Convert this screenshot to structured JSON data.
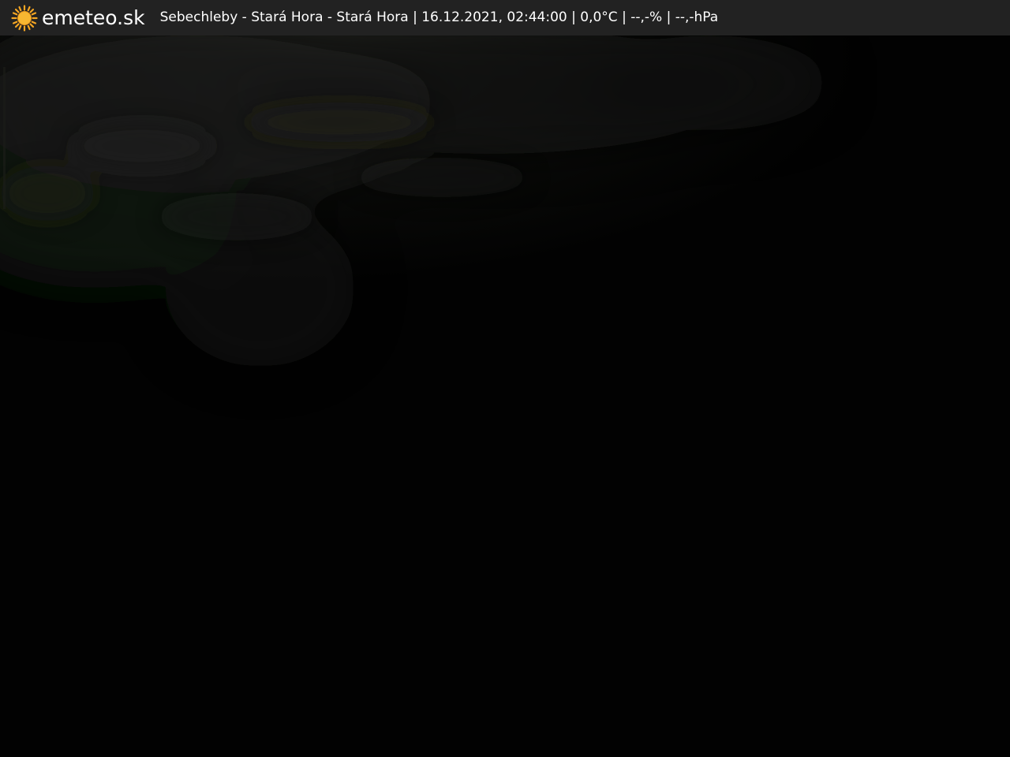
{
  "brand": {
    "name": "emeteo.sk",
    "logo_icon": "sun-icon",
    "logo_color": "#f5a623"
  },
  "overlay": {
    "caption": "Sebechleby - Stará Hora - Stará Hora | 16.12.2021, 02:44:00 | 0,0°C | --,-% | --,-hPa"
  },
  "colors": {
    "bar_background": "#222222",
    "text": "#ffffff",
    "scene": "#020202"
  }
}
